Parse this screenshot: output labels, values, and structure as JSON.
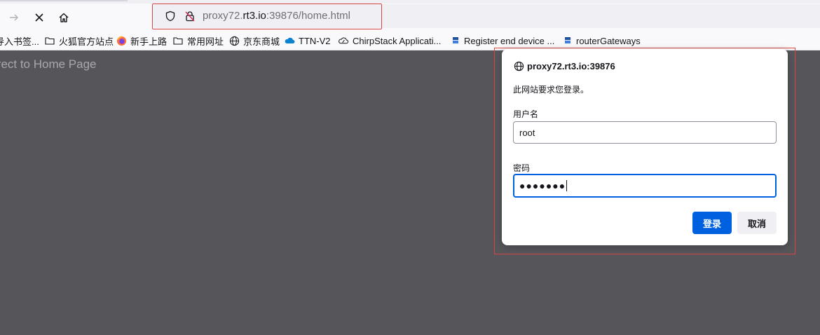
{
  "browser": {
    "url_prefix": "proxy72.",
    "url_host": "rt3.io",
    "url_suffix": ":39876/home.html"
  },
  "bookmarks": [
    {
      "label": "导入书签...",
      "icon": "import-icon"
    },
    {
      "label": "火狐官方站点",
      "icon": "folder-icon"
    },
    {
      "label": "新手上路",
      "icon": "firefox-icon"
    },
    {
      "label": "常用网址",
      "icon": "folder-icon"
    },
    {
      "label": "京东商城",
      "icon": "globe-icon"
    },
    {
      "label": "TTN-V2",
      "icon": "cloud-icon"
    },
    {
      "label": "ChirpStack Applicati...",
      "icon": "chirpstack-icon"
    },
    {
      "label": "Register end device ...",
      "icon": "ttn-icon"
    },
    {
      "label": "routerGateways",
      "icon": "ttn-icon"
    }
  ],
  "page": {
    "text": "irect to Home Page"
  },
  "dialog": {
    "host": "proxy72.rt3.io:39876",
    "message": "此网站要求您登录。",
    "username_label": "用户名",
    "username_value": "root",
    "password_label": "密码",
    "password_mask": "●●●●●●●",
    "login_button": "登录",
    "cancel_button": "取消"
  },
  "colors": {
    "accent": "#0061e0",
    "highlight_box": "#d64545",
    "page_bg": "#56565a"
  }
}
